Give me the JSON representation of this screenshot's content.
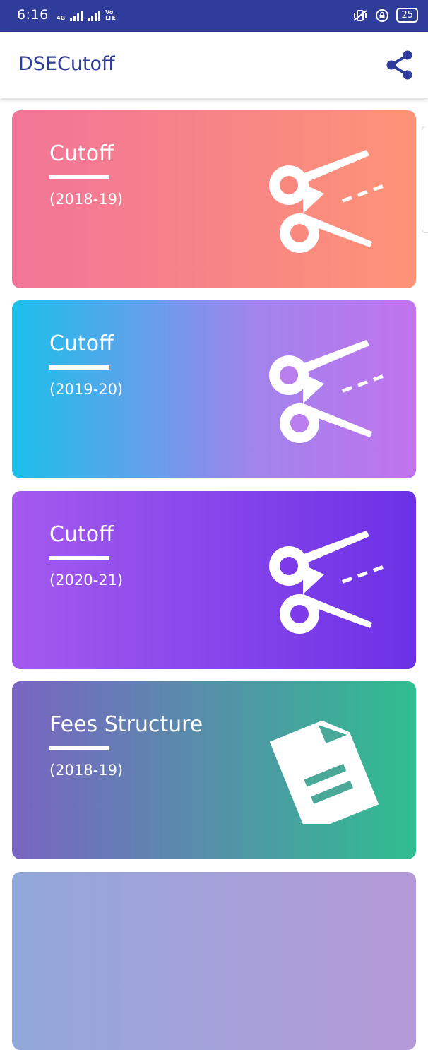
{
  "status_bar": {
    "time": "6:16",
    "network_small": "4G",
    "volte_label": "Vo LTE",
    "battery": "25"
  },
  "app_bar": {
    "title": "DSECutoff",
    "share_icon": "share-icon"
  },
  "cards": [
    {
      "title": "Cutoff",
      "subtitle": "(2018-19)",
      "icon": "scissors-icon",
      "gradient": [
        "#f17598",
        "#fd9376"
      ]
    },
    {
      "title": "Cutoff",
      "subtitle": "(2019-20)",
      "icon": "scissors-icon",
      "gradient": [
        "#1ac0ea",
        "#c173ee"
      ]
    },
    {
      "title": "Cutoff",
      "subtitle": "(2020-21)",
      "icon": "scissors-icon",
      "gradient": [
        "#a45aee",
        "#6b31e6"
      ]
    },
    {
      "title": "Fees Structure",
      "subtitle": "(2018-19)",
      "icon": "document-icon",
      "gradient": [
        "#7a64c2",
        "#2fbe8f"
      ]
    },
    {
      "icon": "",
      "gradient": [
        "#92a8da",
        "#b59ad8"
      ]
    }
  ],
  "colors": {
    "primary": "#2f3c9a"
  }
}
